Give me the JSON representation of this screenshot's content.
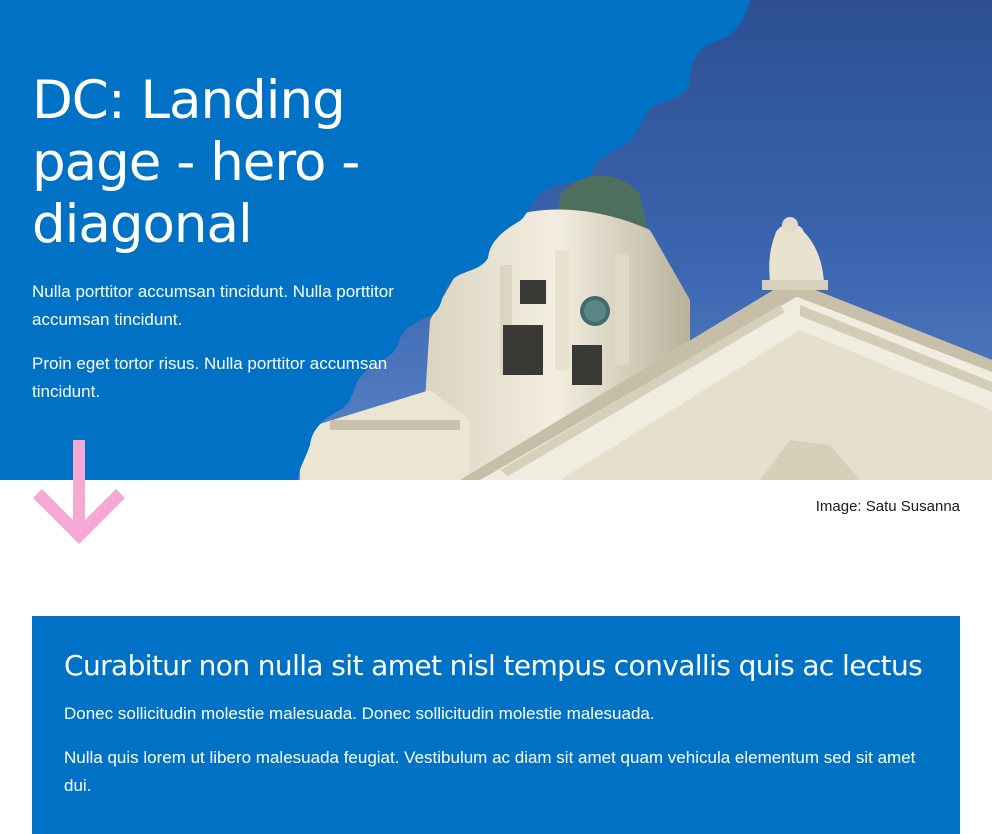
{
  "hero": {
    "title": "DC: Landing page - hero - diagonal",
    "paragraphs": [
      "Nulla porttitor accumsan tincidunt. Nulla porttitor accumsan tincidunt.",
      "Proin eget tortor risus. Nulla porttitor accumsan tincidunt."
    ],
    "image_caption": "Image: Satu Susanna",
    "background_color": "#0072c6",
    "arrow_color": "#f5a8d4",
    "arrow_icon": "arrow-down-icon"
  },
  "info_box": {
    "heading": "Curabitur non nulla sit amet nisl tempus convallis quis ac lectus",
    "paragraphs": [
      "Donec sollicitudin molestie malesuada. Donec sollicitudin molestie malesuada.",
      "Nulla quis lorem ut libero malesuada feugiat. Vestibulum ac diam sit amet quam vehicula elementum sed sit amet dui."
    ],
    "background_color": "#0072c6"
  }
}
